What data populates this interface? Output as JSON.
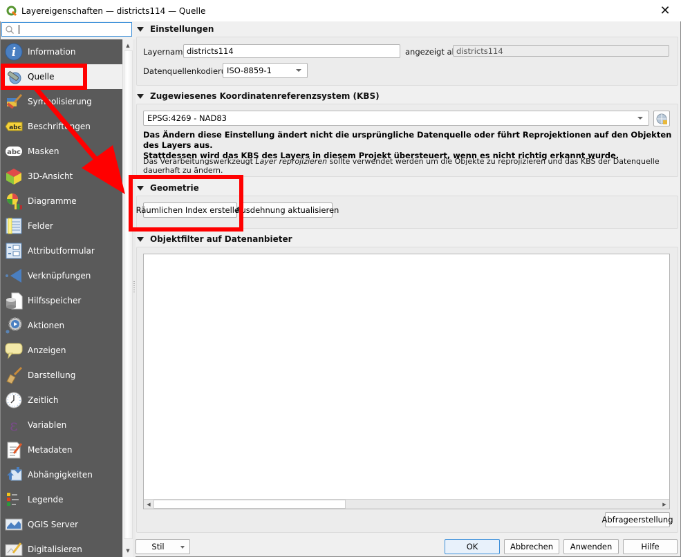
{
  "window": {
    "title": "Layereigenschaften  — districts114 — Quelle",
    "close_icon": "close-icon"
  },
  "search": {
    "placeholder": "",
    "value": "",
    "icon": "search-icon"
  },
  "sidebar": {
    "items": [
      {
        "label": "Information",
        "icon": "info-icon",
        "active": false
      },
      {
        "label": "Quelle",
        "icon": "source-wrench-icon",
        "active": true
      },
      {
        "label": "Symbolisierung",
        "icon": "paintbrush-icon",
        "active": false
      },
      {
        "label": "Beschriftungen",
        "icon": "labels-abc-icon",
        "active": false
      },
      {
        "label": "Masken",
        "icon": "masks-abc-icon",
        "active": false
      },
      {
        "label": "3D-Ansicht",
        "icon": "cube-3d-icon",
        "active": false
      },
      {
        "label": "Diagramme",
        "icon": "diagram-icon",
        "active": false
      },
      {
        "label": "Felder",
        "icon": "fields-table-icon",
        "active": false
      },
      {
        "label": "Attributformular",
        "icon": "attribute-form-icon",
        "active": false
      },
      {
        "label": "Verknüpfungen",
        "icon": "joins-icon",
        "active": false
      },
      {
        "label": "Hilfsspeicher",
        "icon": "auxiliary-storage-icon",
        "active": false
      },
      {
        "label": "Aktionen",
        "icon": "actions-gear-icon",
        "active": false
      },
      {
        "label": "Anzeigen",
        "icon": "display-speech-bubble-icon",
        "active": false
      },
      {
        "label": "Darstellung",
        "icon": "rendering-brush-icon",
        "active": false
      },
      {
        "label": "Zeitlich",
        "icon": "temporal-clock-icon",
        "active": false
      },
      {
        "label": "Variablen",
        "icon": "variables-epsilon-icon",
        "active": false
      },
      {
        "label": "Metadaten",
        "icon": "metadata-document-icon",
        "active": false
      },
      {
        "label": "Abhängigkeiten",
        "icon": "dependencies-icon",
        "active": false
      },
      {
        "label": "Legende",
        "icon": "legend-icon",
        "active": false
      },
      {
        "label": "QGIS Server",
        "icon": "qgis-server-map-icon",
        "active": false
      },
      {
        "label": "Digitalisieren",
        "icon": "digitizing-map-icon",
        "active": false
      }
    ]
  },
  "settings": {
    "header": "Einstellungen",
    "layername_label": "Layername",
    "layername_value": "districts114",
    "displayed_as_label": "angezeigt als",
    "displayed_as_value": "districts114",
    "encoding_label": "Datenquellenkodierung",
    "encoding_value": "ISO-8859-1"
  },
  "crs": {
    "header": "Zugewiesenes Koordinatenreferenzsystem (KBS)",
    "value": "EPSG:4269 - NAD83",
    "select_button_icon": "crs-select-globe-icon",
    "warning_line1": "Das Ändern diese Einstellung ändert nicht die ursprüngliche Datenquelle oder führt Reprojektionen auf den Objekten des Layers aus.",
    "warning_line2": "Stattdessen wird das KBS des Layers in diesem Projekt übersteuert, wenn es nicht richtig erkannt wurde.",
    "info_prefix": "Das Verarbeitungswerkzeugt ",
    "info_tool": "Layer reprojizieren",
    "info_suffix": " sollte verwendet werden um die Objekte zu reprojizieren und das KBS der Datenquelle dauerhaft zu ändern."
  },
  "geometry": {
    "header": "Geometrie",
    "create_index_button": "Räumlichen Index erstellen",
    "update_extent_button": "Ausdehnung aktualisieren"
  },
  "filter": {
    "header": "Objektfilter auf Datenanbieter",
    "value": "",
    "query_builder_button": "Abfrageerstellung"
  },
  "footer": {
    "style_button": "Stil",
    "ok_button": "OK",
    "cancel_button": "Abbrechen",
    "apply_button": "Anwenden",
    "help_button": "Hilfe"
  },
  "annotation_color": "#ff0000"
}
